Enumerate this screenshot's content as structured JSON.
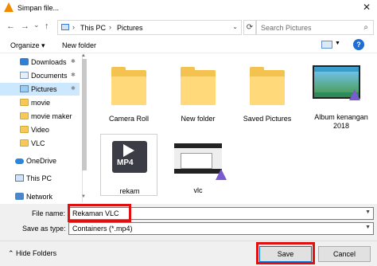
{
  "window": {
    "title": "Simpan file...",
    "close_glyph": "✕"
  },
  "nav": {
    "back": "←",
    "forward": "→",
    "up_history": "⌄",
    "up": "↑",
    "refresh": "⟳",
    "chevron": "›",
    "dropdown": "⌄"
  },
  "address": {
    "crumbs": [
      "This PC",
      "Pictures"
    ]
  },
  "search": {
    "placeholder": "Search Pictures",
    "icon": "search-icon"
  },
  "toolbar": {
    "organize": "Organize ▾",
    "new_folder": "New folder",
    "help": "?"
  },
  "sidebar": {
    "items": [
      {
        "label": "Downloads",
        "icon": "download-icon",
        "pinned": true
      },
      {
        "label": "Documents",
        "icon": "documents-icon",
        "pinned": true
      },
      {
        "label": "Pictures",
        "icon": "pictures-icon",
        "pinned": true,
        "selected": true
      },
      {
        "label": "movie",
        "icon": "folder-icon"
      },
      {
        "label": "movie maker",
        "icon": "folder-icon"
      },
      {
        "label": "Video",
        "icon": "folder-icon"
      },
      {
        "label": "VLC",
        "icon": "folder-icon"
      },
      {
        "label": "OneDrive",
        "icon": "onedrive-icon"
      },
      {
        "label": "This PC",
        "icon": "pc-icon"
      },
      {
        "label": "Network",
        "icon": "network-icon"
      }
    ],
    "pin_glyph": "✱"
  },
  "files": [
    {
      "name": "Camera Roll",
      "type": "folder"
    },
    {
      "name": "New folder",
      "type": "folder"
    },
    {
      "name": "Saved Pictures",
      "type": "folder"
    },
    {
      "name": "Album kenangan 2018",
      "type": "video"
    },
    {
      "name": "rekam",
      "type": "mp4"
    },
    {
      "name": "vlc",
      "type": "video"
    }
  ],
  "mp4_label": "MP4",
  "form": {
    "filename_label": "File name:",
    "filename_value": "Rekaman VLC",
    "savetype_label": "Save as type:",
    "savetype_value": "Containers (*.mp4)"
  },
  "footer": {
    "hide_folders": "Hide Folders",
    "save": "Save",
    "cancel": "Cancel"
  },
  "colors": {
    "highlight": "#e01010",
    "accent": "#0078d7",
    "selection": "#cce8ff"
  }
}
